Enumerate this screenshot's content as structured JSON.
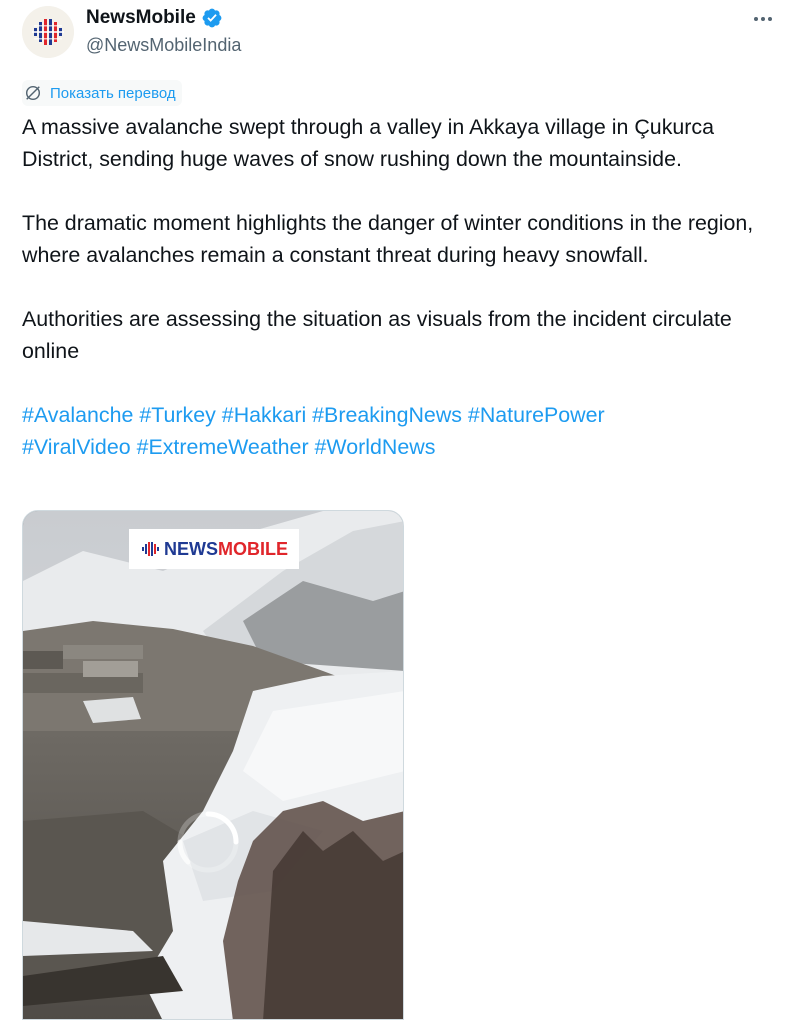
{
  "author": {
    "name": "NewsMobile",
    "handle": "@NewsMobileIndia",
    "verified": true,
    "avatar_icon": "newsmobile-globe-logo"
  },
  "more_icon": "more-horizontal-icon",
  "translate": {
    "label": "Показать перевод",
    "icon": "translate-globe-icon"
  },
  "tweet_text": {
    "p1": "A massive avalanche swept through a valley in Akkaya village in Çukurca District, sending huge waves of snow rushing down the mountainside.",
    "p2": "The dramatic moment highlights the danger of winter conditions in the region, where avalanches remain a constant threat during heavy snowfall.",
    "p3": "Authorities are assessing the situation as visuals from the incident circulate online"
  },
  "hashtags": [
    "#Avalanche",
    "#Turkey",
    "#Hakkari",
    "#BreakingNews",
    "#NaturePower",
    "#ViralVideo",
    "#ExtremeWeather",
    "#WorldNews"
  ],
  "media": {
    "type": "video",
    "watermark": "NEWSMOBILE",
    "loading": true
  },
  "colors": {
    "link": "#1d9bf0",
    "verified": "#1d9bf0",
    "secondary_text": "#536471",
    "watermark_blue": "#1f3a93",
    "watermark_red": "#e0262b"
  }
}
